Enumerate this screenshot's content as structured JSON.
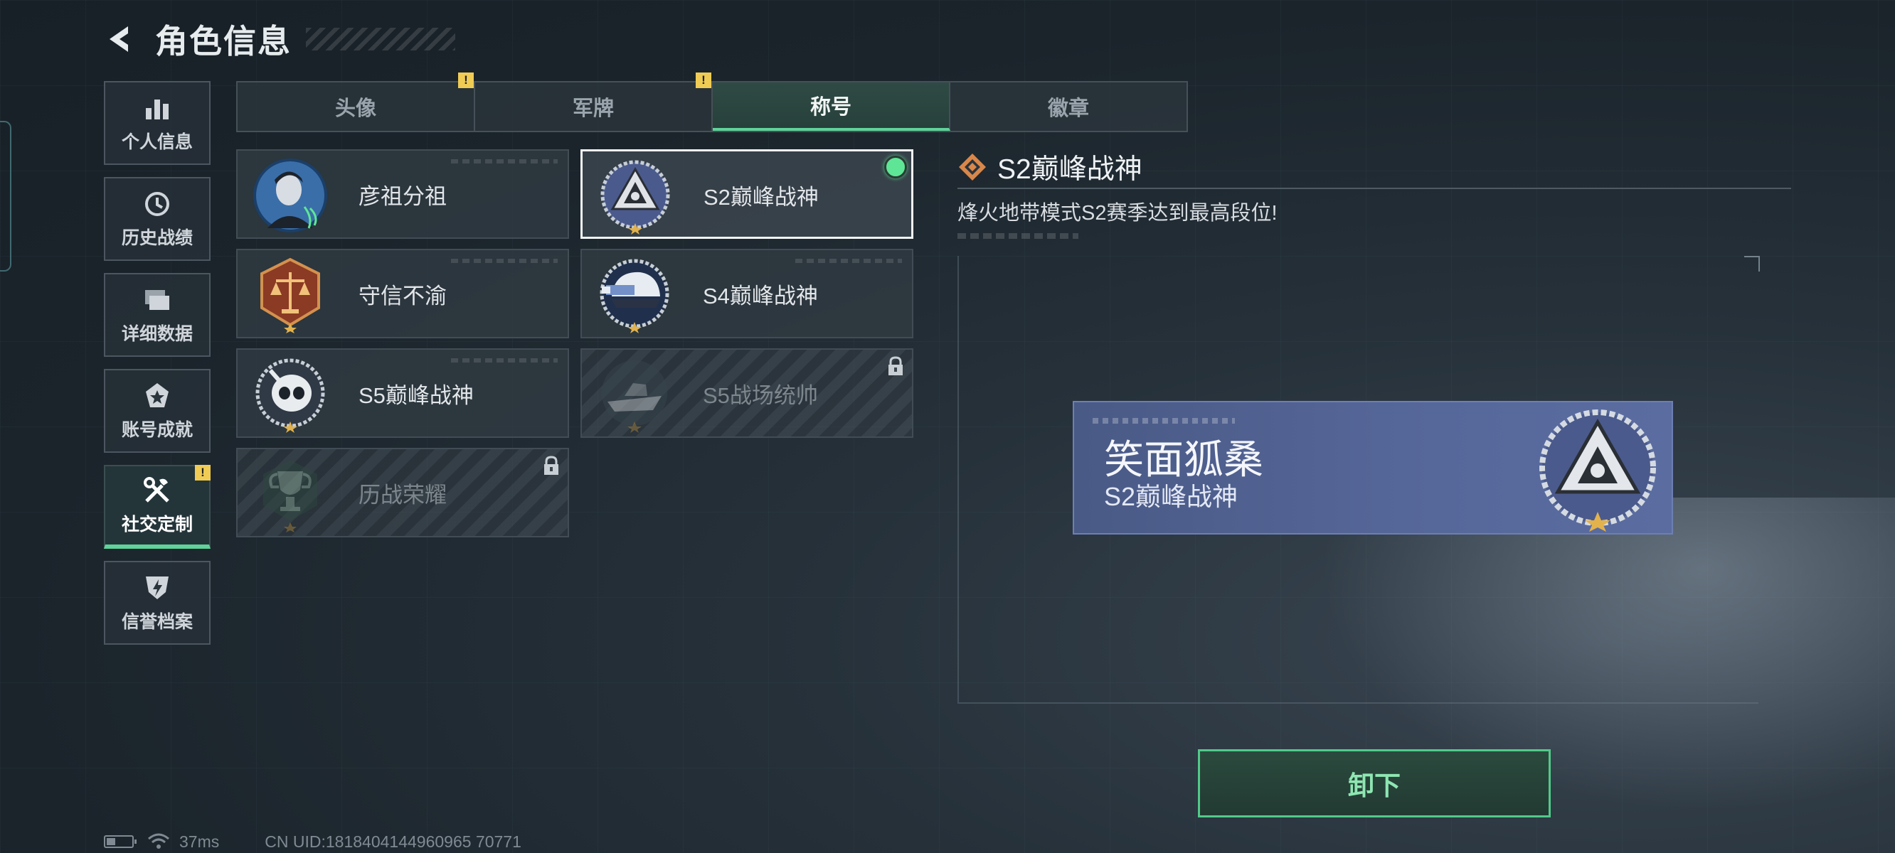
{
  "header": {
    "title": "角色信息"
  },
  "side_nav": {
    "items": [
      {
        "label": "个人信息",
        "icon": "bar-chart-icon",
        "badge": ""
      },
      {
        "label": "历史战绩",
        "icon": "history-clock-icon",
        "badge": ""
      },
      {
        "label": "详细数据",
        "icon": "folders-icon",
        "badge": ""
      },
      {
        "label": "账号成就",
        "icon": "achievement-star-icon",
        "badge": ""
      },
      {
        "label": "社交定制",
        "icon": "tools-icon",
        "badge": "!"
      },
      {
        "label": "信誉档案",
        "icon": "shield-bolt-icon",
        "badge": ""
      }
    ],
    "active_index": 4
  },
  "tabs": [
    {
      "label": "头像",
      "badge": "!"
    },
    {
      "label": "军牌",
      "badge": "!"
    },
    {
      "label": "称号",
      "badge": ""
    },
    {
      "label": "徽章",
      "badge": ""
    }
  ],
  "active_tab": 2,
  "titles": [
    {
      "label": "彦祖分祖",
      "locked": false,
      "selected": false,
      "emblem": "portrait-avatar-icon"
    },
    {
      "label": "S2巅峰战神",
      "locked": false,
      "selected": true,
      "emblem": "peak-triangle-emblem-icon"
    },
    {
      "label": "守信不渝",
      "locked": false,
      "selected": false,
      "emblem": "justice-scale-emblem-icon"
    },
    {
      "label": "S4巅峰战神",
      "locked": false,
      "selected": false,
      "emblem": "helmet-emblem-icon"
    },
    {
      "label": "S5巅峰战神",
      "locked": false,
      "selected": false,
      "emblem": "skull-mask-emblem-icon"
    },
    {
      "label": "S5战场统帅",
      "locked": true,
      "selected": false,
      "emblem": "boat-emblem-icon"
    },
    {
      "label": "历战荣耀",
      "locked": true,
      "selected": false,
      "emblem": "trophy-emblem-icon"
    }
  ],
  "detail": {
    "title": "S2巅峰战神",
    "description": "烽火地带模式S2赛季达到最高段位!"
  },
  "nameplate": {
    "player_name": "笑面狐桑",
    "title": "S2巅峰战神"
  },
  "actions": {
    "unequip_label": "卸下"
  },
  "status_bar": {
    "latency": "37ms",
    "uid": "CN UID:1818404144960965 70771",
    "battery_level": 0.35
  },
  "colors": {
    "accent_green": "#5fd39a",
    "warning_yellow": "#f0cc55",
    "nameplate_blue": "#56679a"
  }
}
